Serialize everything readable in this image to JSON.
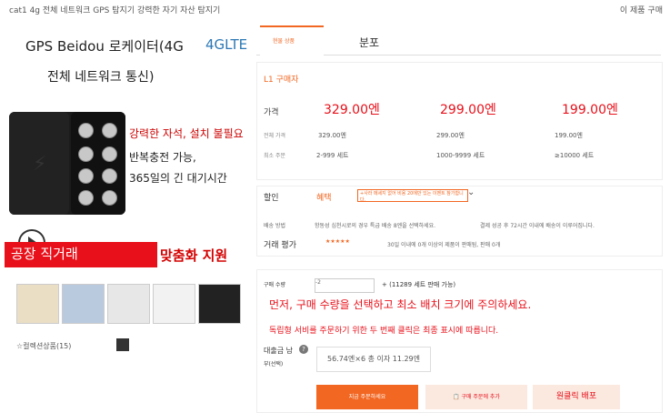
{
  "top": {
    "title": "cat1 4g 전체 네트워크 GPS 탐지기 강력한 자기 자산 탐지기",
    "right": "이 제품 구매"
  },
  "product": {
    "title_line1": "GPS Beidou 로케이터(4G",
    "lte": "4GLTE",
    "title_line2": "전체 네트워크 통신)",
    "feature1": "강력한 자석, 설치 불필요",
    "feature2": "반복충전 가능,",
    "feature3": "365일의 긴 대기시간",
    "factory": "공장 직거래",
    "custom": "맞춤화 지원",
    "collect": "☆컬렉션상품(15)"
  },
  "tabs": {
    "active": "현물 상품",
    "dist": "분포"
  },
  "price": {
    "buyer": "L1 구매자",
    "tiny_right": "",
    "label": "가격",
    "prices": [
      "329.00엔",
      "299.00엔",
      "199.00엔"
    ],
    "qty_label": "전체 가격",
    "qty_vals": [
      "329.00엔",
      "299.00엔",
      "199.00엔"
    ],
    "moq_label": "최소 주문",
    "moq_vals": [
      "2-999 세트",
      "1000-9999 세트",
      "≥10000 세트"
    ]
  },
  "promo": {
    "label": "할인",
    "tag": "혜택",
    "box": "+사라 메세지 없어 비용 20에만 있는 이벤트 참가합니다.",
    "ship_label": "배송 방법",
    "ship": "항동성 심천시로의 경우 특급 배송 8엔을 선택하세요.",
    "ship_right": "결제 성공 후 72시간 이내에 배송이 이루어집니다.",
    "rating_label": "거래 평가",
    "stars": "★★★★★",
    "rating_text": "30일 이내에 0개 이상의 제품이 판매됨, 판매 0개"
  },
  "order": {
    "qty_title": "구매 수량",
    "stepper": "-2",
    "stock": "+ (11289 세트 판매 가능)",
    "notice1": "먼저, 구매 수량을 선택하고 최소 배치 크기에 주의하세요.",
    "notice2": "독립형 서비를 주문하기 위한 두 번째 클릭은 최종 표시에 따릅니다.",
    "total_label": "대출금 남",
    "optional": "부(선택)",
    "total": "56.74엔×6 총 이자 11.29엔",
    "buy": "지금 주문하세요",
    "cart": "구매 주문에 추가",
    "one_click": "원클릭 배포"
  }
}
